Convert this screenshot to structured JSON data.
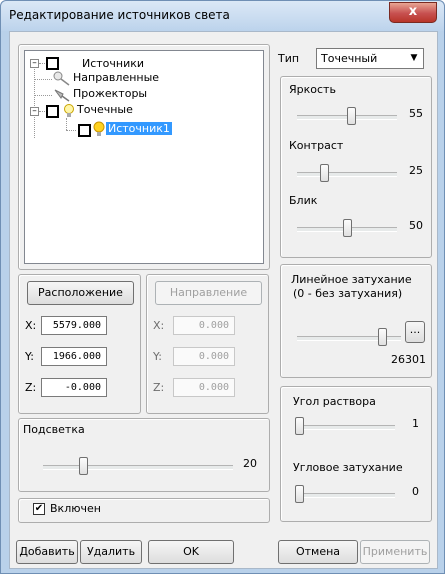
{
  "window": {
    "title": "Редактирование источников света",
    "close": "x"
  },
  "tree": {
    "items": [
      {
        "label": "Источники"
      },
      {
        "label": "Направленные"
      },
      {
        "label": "Прожекторы"
      },
      {
        "label": "Точечные"
      },
      {
        "label": "Источник1"
      }
    ]
  },
  "position": {
    "button": "Расположение",
    "x_label": "X:",
    "x_value": "5579.000",
    "y_label": "Y:",
    "y_value": "1966.000",
    "z_label": "Z:",
    "z_value": "-0.000"
  },
  "direction": {
    "button": "Направление",
    "x_label": "X:",
    "x_value": "0.000",
    "y_label": "Y:",
    "y_value": "0.000",
    "z_label": "Z:",
    "z_value": "0.000"
  },
  "backlight": {
    "label": "Подсветка",
    "value": "20",
    "level": 0.2
  },
  "enabled": {
    "label": "Включен",
    "checked": true,
    "mark": "✔"
  },
  "type": {
    "label": "Тип",
    "value": "Точечный",
    "arrow": "▼"
  },
  "brightness": {
    "label": "Яркость",
    "value": "55",
    "level": 0.55
  },
  "contrast": {
    "label": "Контраст",
    "value": "25",
    "level": 0.25
  },
  "glare": {
    "label": "Блик",
    "value": "50",
    "level": 0.5
  },
  "attenuation": {
    "label_line1": "Линейное затухание",
    "label_line2": "(0 - без затухания)",
    "value": "26301",
    "browse": "...",
    "level": 0.85
  },
  "angle": {
    "label": "Угол раствора",
    "value": "1",
    "level": 0.0
  },
  "angular_attenuation": {
    "label": "Угловое затухание",
    "value": "0",
    "level": 0.0
  },
  "buttons": {
    "add": "Добавить",
    "delete": "Удалить",
    "ok": "OK",
    "cancel": "Отмена",
    "apply": "Применить"
  }
}
